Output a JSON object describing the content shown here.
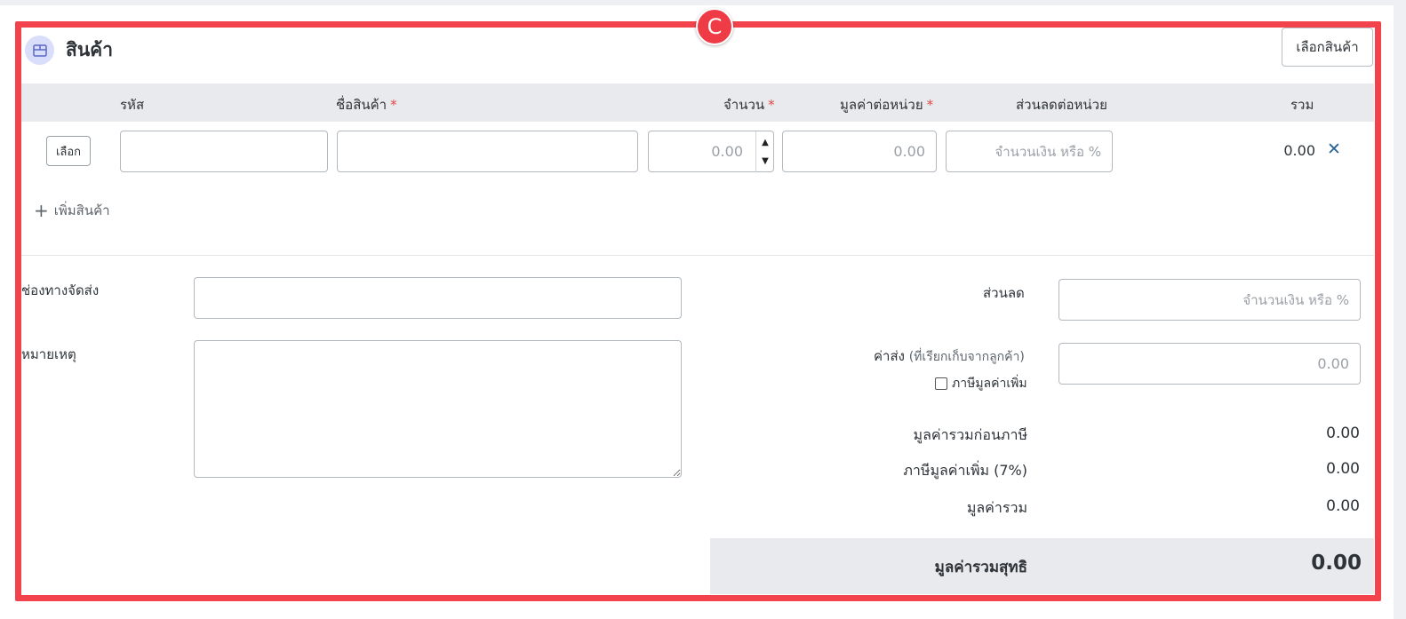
{
  "badge": "C",
  "section": {
    "title": "สินค้า",
    "icon": "box-icon",
    "select_product_button": "เลือกสินค้า"
  },
  "table": {
    "headers": {
      "code": "รหัส",
      "name": "ชื่อสินค้า",
      "quantity": "จำนวน",
      "unit_price": "มูลค่าต่อหน่วย",
      "unit_discount": "ส่วนลดต่อหน่วย",
      "total": "รวม"
    },
    "required_mark": "*",
    "rows": [
      {
        "choose_button": "เลือก",
        "code": "",
        "name": "",
        "quantity_placeholder": "0.00",
        "unit_price_placeholder": "0.00",
        "discount_placeholder": "จำนวนเงิน หรือ %",
        "total": "0.00",
        "remove_icon": "✕"
      }
    ],
    "add_product": "เพิ่มสินค้า",
    "add_icon": "+"
  },
  "form": {
    "shipping_channel_label": "ช่องทางจัดส่ง",
    "shipping_channel_value": "",
    "note_label": "หมายเหตุ",
    "note_value": ""
  },
  "summary": {
    "discount_label": "ส่วนลด",
    "discount_placeholder": "จำนวนเงิน หรือ %",
    "shipping_fee_label": "ค่าส่ง",
    "shipping_fee_sub": "(ที่เรียกเก็บจากลูกค้า)",
    "shipping_fee_placeholder": "0.00",
    "vat_checkbox_label": "ภาษีมูลค่าเพิ่ม",
    "vat_checked": false,
    "subtotal_label": "มูลค่ารวมก่อนภาษี",
    "subtotal_value": "0.00",
    "vat_label": "ภาษีมูลค่าเพิ่ม (7%)",
    "vat_value": "0.00",
    "total_label": "มูลค่ารวม",
    "total_value": "0.00",
    "net_label": "มูลค่ารวมสุทธิ",
    "net_value": "0.00"
  },
  "colors": {
    "highlight_frame": "#f2434c",
    "header_bg": "#e8eaed",
    "required": "#e04848",
    "remove_icon": "#2a6496"
  }
}
